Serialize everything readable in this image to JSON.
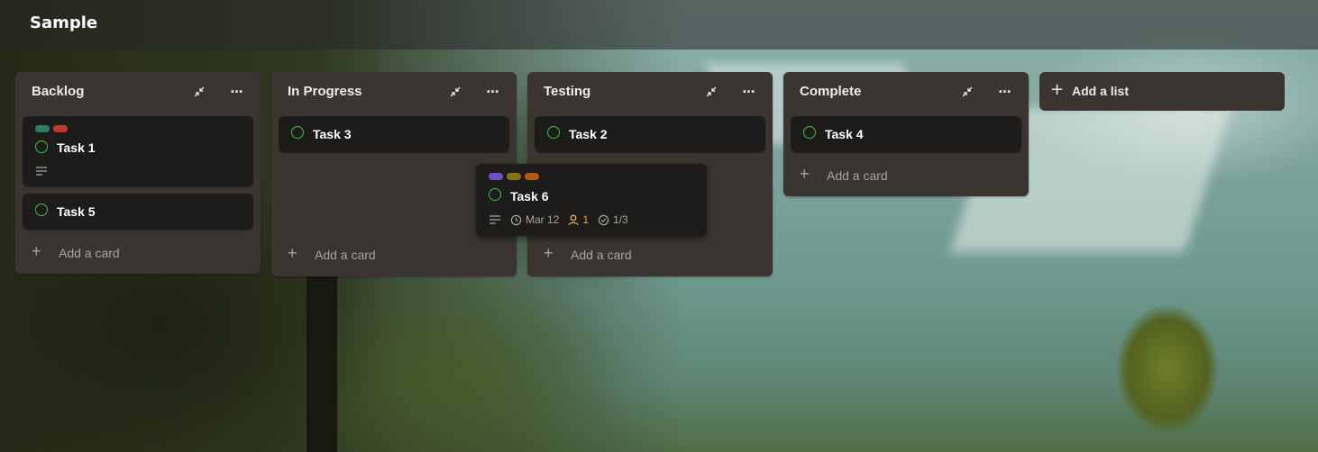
{
  "board": {
    "title": "Sample"
  },
  "colors": {
    "list_bg": "#3a3530",
    "card_bg": "#1e1c1a",
    "check": "#3fbf3f",
    "label_green": "#2f7d5f",
    "label_red": "#c0392b",
    "label_purple": "#6c4fc9",
    "label_olive": "#8a7412",
    "label_orange": "#b35a12"
  },
  "lists": [
    {
      "title": "Backlog",
      "cards": [
        {
          "title": "Task 1",
          "labels": [
            "label_green",
            "label_red"
          ],
          "has_description": true
        },
        {
          "title": "Task 5",
          "labels": [],
          "has_description": false
        }
      ],
      "add_card_label": "Add a card"
    },
    {
      "title": "In Progress",
      "cards": [
        {
          "title": "Task 3",
          "labels": [],
          "has_description": false
        }
      ],
      "add_card_label": "Add a card"
    },
    {
      "title": "Testing",
      "cards": [
        {
          "title": "Task 2",
          "labels": [],
          "has_description": false
        }
      ],
      "add_card_label": "Add a card"
    },
    {
      "title": "Complete",
      "cards": [
        {
          "title": "Task 4",
          "labels": [],
          "has_description": false
        }
      ],
      "add_card_label": "Add a card"
    }
  ],
  "add_list_label": "Add a list",
  "dragged_card": {
    "title": "Task 6",
    "labels": [
      "label_purple",
      "label_olive",
      "label_orange"
    ],
    "due_date": "Mar 12",
    "assignees": "1",
    "checklist": "1/3"
  },
  "icons": {
    "collapse": "collapse-icon",
    "more": "more-icon",
    "plus": "plus-icon",
    "description": "description-icon",
    "clock": "clock-icon",
    "user": "user-icon",
    "checklist": "checklist-icon"
  }
}
